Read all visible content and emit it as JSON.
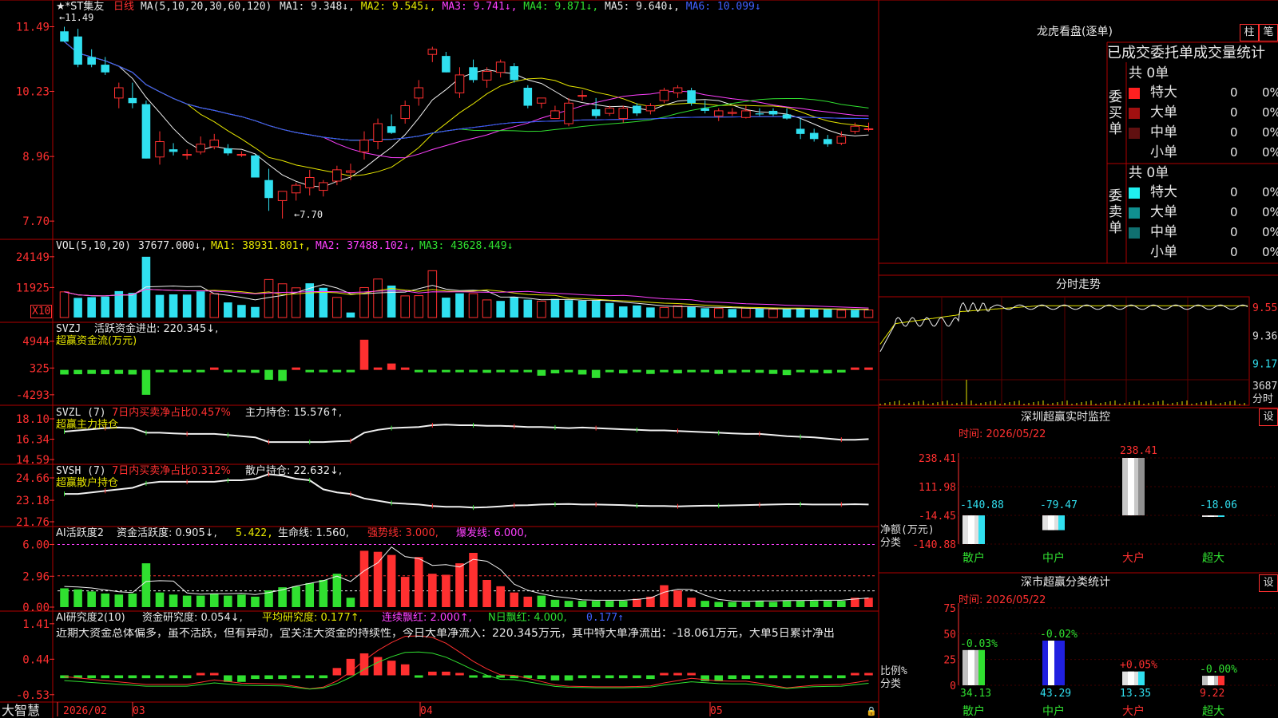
{
  "app": {
    "logo": "大智慧",
    "stock": "★*ST集友",
    "period": "日线"
  },
  "colors": {
    "up": "#ff3030",
    "down": "#30e0f0",
    "green": "#30e030",
    "frame": "#c00000"
  },
  "price_panel": {
    "ma_params": "MA(5,10,20,30,60,120)",
    "ma_labels": [
      {
        "text": "MA1: 9.348↓,",
        "cls": "white"
      },
      {
        "text": "MA2: 9.545↓,",
        "cls": "yellow"
      },
      {
        "text": "MA3: 9.741↓,",
        "cls": "magenta"
      },
      {
        "text": "MA4: 9.871↓,",
        "cls": "green"
      },
      {
        "text": "MA5: 9.640↓,",
        "cls": "white"
      },
      {
        "text": "MA6: 10.099↓",
        "cls": "blue"
      }
    ],
    "axis": [
      "11.49",
      "10.23",
      "8.96",
      "7.70"
    ],
    "high_marker": "←11.49",
    "low_marker": "←7.70"
  },
  "vol_panel": {
    "title": "VOL(5,10,20)",
    "value": "37677.000↓,",
    "ma1": "MA1: 38931.801↑,",
    "ma2": "MA2: 37488.102↓,",
    "ma3": "MA3: 43628.449↓",
    "axis": [
      "24149",
      "11925"
    ],
    "unit": "X10"
  },
  "svzj_panel": {
    "title": "SVZJ",
    "active_label": "活跃资金进出: 220.345↓,",
    "subtitle": "超赢资金流(万元)",
    "axis": [
      "4944",
      "325",
      "-4293"
    ]
  },
  "svzl_panel": {
    "title": "SVZL (7)",
    "ratio": "7日内买卖净占比0.457%",
    "hold": "主力持仓: 15.576↑,",
    "subtitle": "超赢主力持仓",
    "axis": [
      "18.10",
      "16.34",
      "14.59"
    ]
  },
  "svsh_panel": {
    "title": "SVSH (7)",
    "ratio": "7日内买卖净占比0.312%",
    "hold": "散户持仓: 22.632↓,",
    "subtitle": "超赢散户持仓",
    "axis": [
      "24.66",
      "23.18",
      "21.76"
    ]
  },
  "ai1_panel": {
    "title": "AI活跃度2",
    "activity": "资金活跃度: 0.905↓,",
    "v2": "5.422,",
    "life": "生命线: 1.560,",
    "strong": "强势线: 3.000,",
    "burst": "爆发线: 6.000,",
    "axis": [
      "6.00",
      "2.96",
      "0.00"
    ]
  },
  "ai2_panel": {
    "title": "AI研究度2(10)",
    "research": "资金研究度: 0.054↓,",
    "avg": "平均研究度: 0.177↑,",
    "streak": "连续飘红: 2.000↑,",
    "nday": "N日飘红: 4.000,",
    "last": "0.177↑",
    "axis": [
      "1.41",
      "0.44",
      "-0.53"
    ],
    "comment": "近期大资金总体偏多，虽不活跃，但有异动，宜关注大资金的持续性，今日大单净流入：220.345万元，其中特大单净流出：-18.061万元，大单5日累计净出"
  },
  "xaxis": {
    "labels": [
      "2026/02",
      "03",
      "04",
      "05"
    ]
  },
  "dragon": {
    "title": "龙虎看盘(逐单)",
    "btn_zhu": "柱",
    "btn_bi": "笔",
    "header": "已成交委托单成交量统计",
    "buy_label": "委买单",
    "sell_label": "委卖单",
    "buy_total": "共 0单",
    "sell_total": "共 0单",
    "buy_rows": [
      {
        "name": "特大",
        "count": "0",
        "pct": "0%",
        "color": "#ff2020"
      },
      {
        "name": "大单",
        "count": "0",
        "pct": "0%",
        "color": "#a01010"
      },
      {
        "name": "中单",
        "count": "0",
        "pct": "0%",
        "color": "#601010"
      },
      {
        "name": "小单",
        "count": "0",
        "pct": "0%",
        "color": ""
      }
    ],
    "sell_rows": [
      {
        "name": "特大",
        "count": "0",
        "pct": "0%",
        "color": "#20f0f0"
      },
      {
        "name": "大单",
        "count": "0",
        "pct": "0%",
        "color": "#109090"
      },
      {
        "name": "中单",
        "count": "0",
        "pct": "0%",
        "color": "#107070"
      },
      {
        "name": "小单",
        "count": "0",
        "pct": "0%",
        "color": ""
      }
    ]
  },
  "intraday": {
    "title": "分时走势",
    "axis": [
      "9.55",
      "9.36",
      "9.17"
    ],
    "vol_max": "3687",
    "vol_label": "分时"
  },
  "sz_monitor": {
    "title": "深圳超赢实时监控",
    "btn": "设",
    "time": "时间: 2026/05/22",
    "axis": [
      "238.41",
      "111.98",
      "-14.45",
      "-140.88"
    ],
    "ylabel": "净额(万元)",
    "xlabel": "分类"
  },
  "sz_class": {
    "title": "深市超赢分类统计",
    "btn": "设",
    "time": "时间: 2026/05/22",
    "axis": [
      "75",
      "50",
      "25",
      "0"
    ],
    "ylabel": "比例%",
    "xlabel": "分类"
  },
  "chart_data": [
    {
      "type": "candlestick",
      "title": "★*ST集友 日线",
      "ohlc": [
        [
          11.4,
          11.49,
          11.2,
          11.2
        ],
        [
          11.3,
          11.45,
          10.7,
          10.75
        ],
        [
          10.9,
          11.05,
          10.7,
          10.75
        ],
        [
          10.75,
          10.9,
          10.55,
          10.6
        ],
        [
          10.1,
          10.4,
          9.9,
          10.3
        ],
        [
          10.1,
          10.4,
          9.9,
          10.0
        ],
        [
          9.98,
          10.05,
          8.92,
          8.92
        ],
        [
          8.95,
          9.45,
          8.8,
          9.25
        ],
        [
          9.1,
          9.22,
          8.98,
          9.05
        ],
        [
          9.0,
          9.1,
          8.9,
          9.0
        ],
        [
          9.05,
          9.35,
          9.0,
          9.2
        ],
        [
          9.15,
          9.4,
          9.1,
          9.28
        ],
        [
          9.12,
          9.2,
          8.98,
          9.02
        ],
        [
          9.0,
          9.06,
          8.95,
          9.0
        ],
        [
          8.98,
          9.0,
          8.55,
          8.55
        ],
        [
          8.5,
          8.72,
          7.9,
          8.15
        ],
        [
          8.1,
          8.25,
          7.75,
          8.28
        ],
        [
          8.25,
          8.45,
          8.1,
          8.4
        ],
        [
          8.35,
          8.7,
          8.2,
          8.55
        ],
        [
          8.3,
          8.5,
          8.18,
          8.45
        ],
        [
          8.48,
          8.78,
          8.4,
          8.7
        ],
        [
          8.65,
          8.82,
          8.5,
          8.68
        ],
        [
          9.05,
          9.45,
          8.9,
          9.28
        ],
        [
          9.25,
          9.7,
          9.1,
          9.6
        ],
        [
          9.55,
          9.78,
          9.4,
          9.42
        ],
        [
          9.7,
          10.05,
          9.6,
          9.95
        ],
        [
          10.1,
          10.45,
          9.95,
          10.3
        ],
        [
          10.95,
          11.1,
          10.8,
          11.05
        ],
        [
          10.92,
          11.0,
          10.6,
          10.6
        ],
        [
          10.2,
          10.7,
          10.1,
          10.55
        ],
        [
          10.7,
          10.85,
          10.4,
          10.45
        ],
        [
          10.45,
          10.7,
          10.3,
          10.62
        ],
        [
          10.6,
          10.85,
          10.5,
          10.8
        ],
        [
          10.72,
          10.78,
          10.4,
          10.45
        ],
        [
          10.3,
          10.35,
          9.9,
          9.95
        ],
        [
          10.0,
          10.1,
          9.9,
          10.1
        ],
        [
          9.7,
          9.95,
          9.7,
          9.85
        ],
        [
          9.6,
          10.1,
          9.55,
          10.0
        ],
        [
          10.15,
          10.25,
          10.05,
          10.15
        ],
        [
          9.88,
          10.1,
          9.7,
          9.75
        ],
        [
          9.8,
          9.95,
          9.75,
          9.9
        ],
        [
          9.7,
          9.95,
          9.62,
          9.9
        ],
        [
          9.95,
          10.0,
          9.75,
          9.8
        ],
        [
          9.85,
          10.0,
          9.78,
          9.95
        ],
        [
          10.05,
          10.3,
          10.0,
          10.25
        ],
        [
          10.2,
          10.35,
          10.1,
          10.3
        ],
        [
          10.25,
          10.3,
          9.95,
          10.0
        ],
        [
          9.9,
          10.05,
          9.8,
          9.85
        ],
        [
          9.75,
          9.9,
          9.65,
          9.85
        ],
        [
          9.8,
          9.9,
          9.75,
          9.82
        ],
        [
          9.72,
          9.95,
          9.7,
          9.85
        ],
        [
          9.8,
          9.9,
          9.75,
          9.78
        ],
        [
          9.85,
          9.9,
          9.75,
          9.78
        ],
        [
          9.78,
          9.9,
          9.68,
          9.7
        ],
        [
          9.5,
          9.7,
          9.3,
          9.4
        ],
        [
          9.42,
          9.5,
          9.25,
          9.3
        ],
        [
          9.3,
          9.38,
          9.15,
          9.2
        ],
        [
          9.22,
          9.45,
          9.18,
          9.35
        ],
        [
          9.45,
          9.62,
          9.4,
          9.55
        ],
        [
          9.5,
          9.62,
          9.45,
          9.5
        ]
      ],
      "ylim": [
        7.5,
        11.7
      ]
    },
    {
      "type": "bar",
      "title": "VOL(5,10,20)",
      "unit": "X10",
      "values": [
        10200,
        7800,
        8100,
        8300,
        10500,
        9800,
        24149,
        9000,
        9200,
        9100,
        10400,
        9500,
        6000,
        5000,
        4200,
        15100,
        13400,
        11800,
        13600,
        11800,
        8000,
        2000,
        11900,
        15300,
        12700,
        8600,
        8700,
        18600,
        7900,
        9600,
        9500,
        7000,
        6600,
        8100,
        7100,
        6500,
        7400,
        6900,
        6700,
        6700,
        5800,
        4400,
        4800,
        4000,
        4000,
        4700,
        4200,
        3700,
        3600,
        3400,
        3700,
        3500,
        3300,
        3300,
        3600,
        3300,
        3300,
        2900,
        3000,
        3000
      ],
      "up": [
        1,
        0,
        0,
        0,
        0,
        0,
        0,
        0,
        0,
        0,
        0,
        1,
        0,
        0,
        0,
        1,
        1,
        1,
        0,
        0,
        1,
        0,
        1,
        1,
        0,
        1,
        1,
        1,
        0,
        0,
        1,
        1,
        0,
        0,
        0,
        1,
        0,
        0,
        0,
        0,
        0,
        0,
        0,
        0,
        1,
        1,
        0,
        0,
        1,
        0,
        1,
        0,
        1,
        0,
        0,
        0,
        0,
        1,
        0,
        1
      ],
      "ylim": [
        0,
        26000
      ]
    },
    {
      "type": "bar",
      "title": "超赢资金流(万元)",
      "values": [
        -800,
        -750,
        -700,
        -750,
        -700,
        -800,
        -4293,
        -300,
        -150,
        -250,
        -150,
        380,
        -300,
        -200,
        -500,
        -1700,
        -1900,
        350,
        -200,
        -200,
        -100,
        -350,
        5200,
        300,
        1100,
        380,
        -300,
        -150,
        -300,
        -200,
        -150,
        -500,
        -300,
        -200,
        -250,
        -1000,
        -600,
        -300,
        -800,
        -1400,
        -200,
        -600,
        -300,
        -700,
        -300,
        -600,
        -300,
        -400,
        -700,
        -500,
        -300,
        -500,
        -700,
        -900,
        -400,
        -500,
        -600,
        -450,
        400,
        200
      ],
      "ylim": [
        -5000,
        6000
      ]
    },
    {
      "type": "line",
      "title": "超赢主力持仓",
      "values": [
        17.0,
        17.1,
        17.2,
        17.3,
        17.35,
        17.3,
        16.9,
        16.9,
        16.85,
        16.8,
        16.8,
        16.8,
        16.7,
        16.6,
        16.5,
        16.1,
        16.1,
        16.1,
        16.1,
        16.1,
        16.15,
        16.2,
        16.9,
        17.15,
        17.3,
        17.35,
        17.4,
        17.55,
        17.6,
        17.55,
        17.55,
        17.5,
        17.5,
        17.45,
        17.4,
        17.4,
        17.35,
        17.3,
        17.35,
        17.3,
        17.25,
        17.2,
        17.15,
        17.1,
        17.1,
        17.05,
        17.0,
        16.95,
        16.9,
        16.85,
        16.8,
        16.8,
        16.7,
        16.6,
        16.55,
        16.5,
        16.4,
        16.3,
        16.3,
        16.35
      ],
      "ylim": [
        14.59,
        18.1
      ]
    },
    {
      "type": "line",
      "title": "超赢散户持仓",
      "values": [
        23.6,
        23.6,
        23.7,
        23.8,
        23.9,
        24.0,
        24.3,
        24.4,
        24.4,
        24.4,
        24.4,
        24.4,
        24.5,
        24.5,
        24.6,
        24.9,
        24.8,
        24.6,
        24.5,
        23.9,
        23.7,
        23.6,
        23.3,
        23.15,
        23.0,
        22.95,
        22.9,
        22.8,
        22.75,
        22.75,
        22.7,
        22.72,
        22.78,
        22.84,
        22.85,
        22.9,
        22.92,
        22.93,
        22.9,
        22.9,
        22.88,
        22.86,
        22.82,
        22.8,
        22.8,
        22.78,
        22.8,
        22.82,
        22.82,
        22.84,
        22.86,
        22.88,
        22.9,
        22.92,
        22.92,
        22.9,
        22.9,
        22.9,
        22.92,
        22.9
      ],
      "ylim": [
        21.76,
        24.66
      ]
    },
    {
      "type": "bar",
      "title": "AI活跃度2",
      "values": [
        1.8,
        1.7,
        1.5,
        1.3,
        1.2,
        1.3,
        4.2,
        1.4,
        1.2,
        1.1,
        1.1,
        1.3,
        1.1,
        1.2,
        1.0,
        1.6,
        1.9,
        2.0,
        2.3,
        2.6,
        3.2,
        0.9,
        5.4,
        5.3,
        5.0,
        2.9,
        4.8,
        3.2,
        3.1,
        4.2,
        5.2,
        2.6,
        2.0,
        1.4,
        1.0,
        1.1,
        0.7,
        0.6,
        0.6,
        0.6,
        0.6,
        0.6,
        0.8,
        1.0,
        2.1,
        1.6,
        0.9,
        0.6,
        0.5,
        0.5,
        0.5,
        0.6,
        0.5,
        0.6,
        0.6,
        0.6,
        0.6,
        0.6,
        0.9,
        0.9
      ],
      "up": [
        0,
        0,
        0,
        0,
        0,
        0,
        0,
        0,
        0,
        0,
        0,
        0,
        0,
        0,
        0,
        0,
        0,
        0,
        0,
        0,
        0,
        0,
        1,
        1,
        1,
        1,
        1,
        1,
        1,
        1,
        1,
        1,
        1,
        1,
        1,
        0,
        0,
        0,
        0,
        0,
        0,
        0,
        1,
        1,
        1,
        1,
        1,
        0,
        0,
        0,
        0,
        0,
        0,
        0,
        0,
        0,
        0,
        0,
        1,
        1
      ],
      "ylim": [
        0,
        6.5
      ]
    },
    {
      "type": "bar",
      "title": "AI研究度2(10)",
      "values": [
        -0.08,
        -0.08,
        -0.08,
        -0.08,
        -0.08,
        -0.08,
        -0.08,
        -0.08,
        -0.08,
        -0.08,
        0.06,
        0.06,
        -0.18,
        -0.18,
        -0.1,
        -0.1,
        -0.1,
        -0.08,
        -0.08,
        -0.08,
        0.2,
        0.45,
        0.6,
        0.5,
        0.4,
        0.3,
        -0.05,
        0.1,
        0.1,
        0.06,
        -0.06,
        -0.06,
        -0.06,
        -0.08,
        -0.08,
        -0.1,
        -0.14,
        -0.14,
        -0.08,
        -0.08,
        -0.08,
        -0.08,
        -0.08,
        -0.1,
        0.04,
        0.06,
        0.06,
        -0.16,
        -0.16,
        -0.1,
        -0.1,
        -0.08,
        -0.08,
        -0.08,
        -0.08,
        -0.08,
        -0.08,
        -0.08,
        0.04,
        0.05
      ],
      "ylim": [
        -0.6,
        1.45
      ]
    },
    {
      "type": "bar",
      "title": "深圳超赢实时监控",
      "categories": [
        "散户",
        "中户",
        "大户",
        "超大"
      ],
      "values": [
        -140.88,
        -79.47,
        238.41,
        -18.06
      ],
      "ylim": [
        -140.88,
        238.41
      ]
    },
    {
      "type": "bar",
      "title": "深市超赢分类统计",
      "categories": [
        "散户",
        "中户",
        "大户",
        "超大"
      ],
      "values": [
        34.13,
        43.29,
        13.35,
        9.22
      ],
      "changes": [
        "-0.03%",
        "-0.02%",
        "+0.05%",
        "-0.00%"
      ],
      "ylim": [
        0,
        75
      ]
    }
  ]
}
